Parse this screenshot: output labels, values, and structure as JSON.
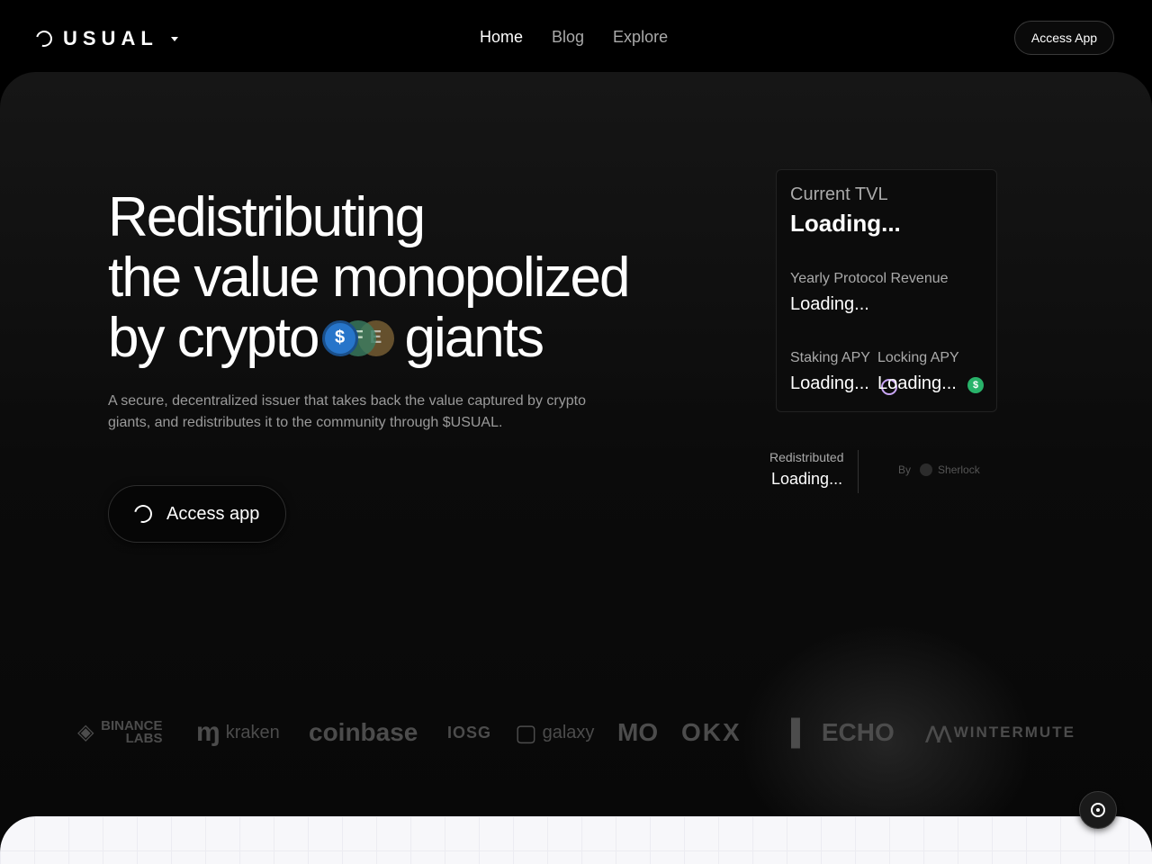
{
  "nav": {
    "logo_text": "USUAL",
    "links": [
      {
        "label": "Home",
        "active": true
      },
      {
        "label": "Blog",
        "active": false
      },
      {
        "label": "Explore",
        "active": false
      }
    ],
    "access_button": "Access App"
  },
  "hero": {
    "line1": "Redistributing",
    "line2": "the value monopolized",
    "line3a": "by crypto",
    "line3b": "giants",
    "coins": [
      {
        "symbol": "$",
        "color": "#2775ca"
      },
      {
        "symbol": "F",
        "color": "#3a7e62"
      },
      {
        "symbol": "E",
        "color": "#8a6d3b"
      }
    ],
    "subtitle": "A secure, decentralized issuer that takes back the value captured by crypto giants, and redistributes it to the community through $USUAL.",
    "cta_label": "Access app"
  },
  "stats": {
    "tvl_label": "Current TVL",
    "tvl_value": "Loading...",
    "revenue_label": "Yearly Protocol Revenue",
    "revenue_value": "Loading...",
    "staking_label": "Staking APY",
    "staking_value": "Loading...",
    "locking_label": "Locking APY",
    "locking_value": "Loading...",
    "green_coin_symbol": "$"
  },
  "redistributed": {
    "label": "Redistributed",
    "value": "Loading...",
    "by_label": "By",
    "by_name": "Sherlock"
  },
  "partners": [
    {
      "name": "BINANCE LABS",
      "icon": "◈"
    },
    {
      "name": "kraken",
      "icon": "ɱ"
    },
    {
      "name": "coinbase",
      "icon": ""
    },
    {
      "name": "IOSG",
      "icon": ""
    },
    {
      "name": "galaxy",
      "icon": "▢"
    },
    {
      "name": "MO",
      "icon": ""
    },
    {
      "name": "OKX",
      "icon": ""
    },
    {
      "name": "ECHO",
      "icon": "▌"
    },
    {
      "name": "WINTERMUTE",
      "icon": "⋀⋀"
    }
  ]
}
